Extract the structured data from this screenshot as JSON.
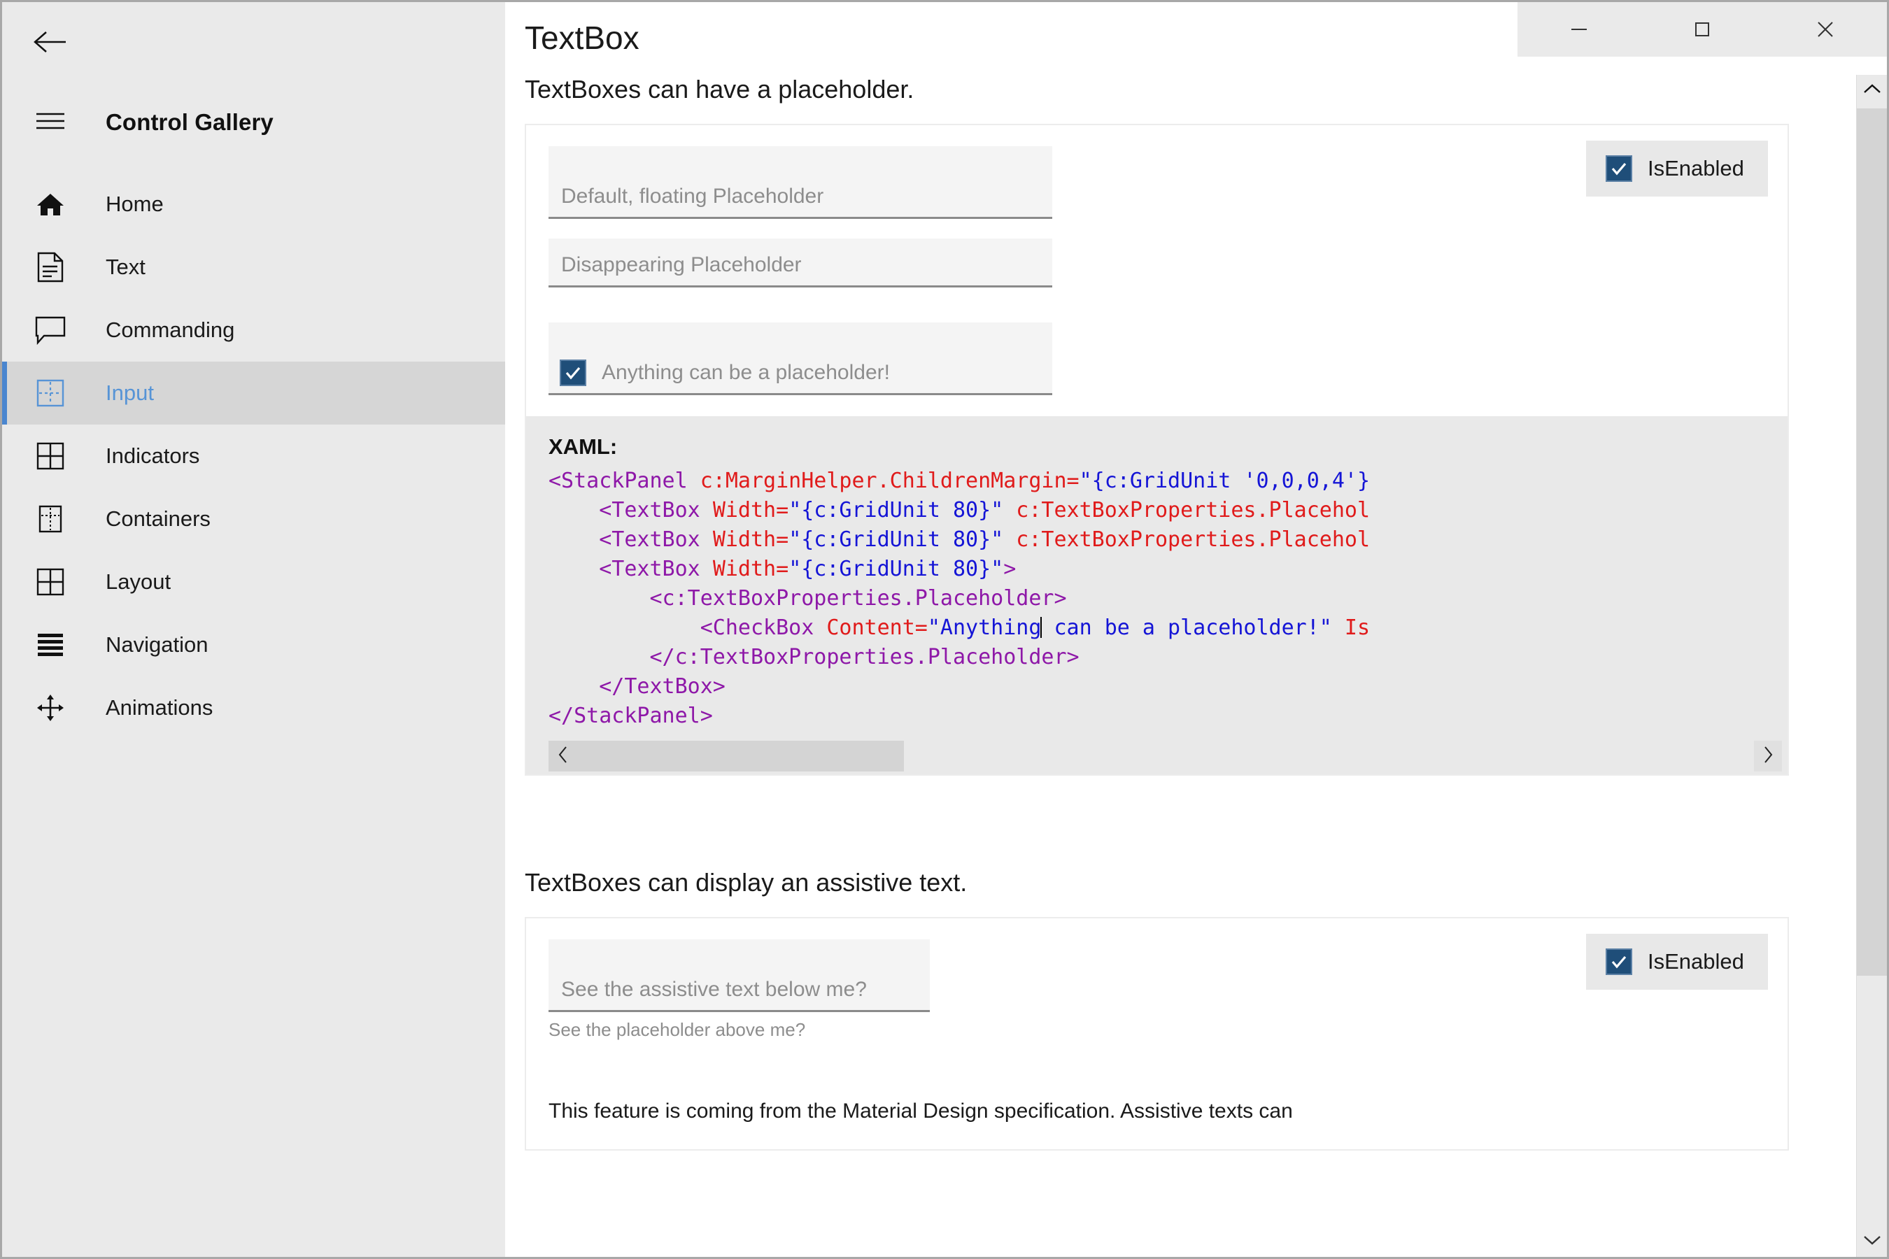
{
  "window": {
    "controls": [
      {
        "name": "minimize",
        "glyph": "minimize-icon"
      },
      {
        "name": "maximize",
        "glyph": "maximize-icon"
      },
      {
        "name": "close",
        "glyph": "close-icon"
      }
    ]
  },
  "sidebar": {
    "back_label": "back-arrow-icon",
    "menu_label": "hamburger-icon",
    "brand": "Control Gallery",
    "items": [
      {
        "label": "Home",
        "icon": "home-icon",
        "selected": false
      },
      {
        "label": "Text",
        "icon": "document-icon",
        "selected": false
      },
      {
        "label": "Commanding",
        "icon": "chat-bubble-icon",
        "selected": false
      },
      {
        "label": "Input",
        "icon": "input-grid-icon",
        "selected": true
      },
      {
        "label": "Indicators",
        "icon": "grid-icon",
        "selected": false
      },
      {
        "label": "Containers",
        "icon": "container-icon",
        "selected": false
      },
      {
        "label": "Layout",
        "icon": "grid-icon",
        "selected": false
      },
      {
        "label": "Navigation",
        "icon": "lines-icon",
        "selected": false
      },
      {
        "label": "Animations",
        "icon": "move-icon",
        "selected": false
      }
    ]
  },
  "main": {
    "title": "TextBox",
    "sections": [
      {
        "heading": "TextBoxes can have a placeholder.",
        "is_enabled_label": "IsEnabled",
        "is_enabled_checked": true,
        "textboxes": [
          {
            "placeholder": "Default, floating Placeholder",
            "value": "",
            "kind": "floating"
          },
          {
            "placeholder": "Disappearing Placeholder",
            "value": "",
            "kind": "plain"
          }
        ],
        "checkbox_placeholder": "Anything can be a placeholder!",
        "checkbox_placeholder_checked": true
      },
      {
        "heading": "TextBoxes can display an assistive text.",
        "is_enabled_label": "IsEnabled",
        "is_enabled_checked": true,
        "textbox": {
          "placeholder": "See the assistive text below me?",
          "value": ""
        },
        "assistive_text": "See the placeholder above me?",
        "note": "This feature is coming from the Material Design specification. Assistive texts can"
      }
    ]
  },
  "xaml": {
    "label": "XAML:",
    "lines": [
      [
        {
          "t": "tag",
          "s": "<StackPanel "
        },
        {
          "t": "attr",
          "s": "c:MarginHelper.ChildrenMargin"
        },
        {
          "t": "eq",
          "s": "="
        },
        {
          "t": "val",
          "s": "\"{c:GridUnit '0,0,0,4'}"
        }
      ],
      [
        {
          "t": "tag",
          "s": "    <TextBox "
        },
        {
          "t": "attr",
          "s": "Width"
        },
        {
          "t": "eq",
          "s": "="
        },
        {
          "t": "val",
          "s": "\"{c:GridUnit 80}\""
        },
        {
          "t": "attr",
          "s": " c:TextBoxProperties.Placehol"
        }
      ],
      [
        {
          "t": "tag",
          "s": "    <TextBox "
        },
        {
          "t": "attr",
          "s": "Width"
        },
        {
          "t": "eq",
          "s": "="
        },
        {
          "t": "val",
          "s": "\"{c:GridUnit 80}\""
        },
        {
          "t": "attr",
          "s": " c:TextBoxProperties.Placehol"
        }
      ],
      [
        {
          "t": "tag",
          "s": "    <TextBox "
        },
        {
          "t": "attr",
          "s": "Width"
        },
        {
          "t": "eq",
          "s": "="
        },
        {
          "t": "val",
          "s": "\"{c:GridUnit 80}\""
        },
        {
          "t": "tag",
          "s": ">"
        }
      ],
      [
        {
          "t": "tag",
          "s": "        <c:TextBoxProperties.Placeholder>"
        }
      ],
      [
        {
          "t": "tag",
          "s": "            <CheckBox "
        },
        {
          "t": "attr",
          "s": "Content"
        },
        {
          "t": "eq",
          "s": "="
        },
        {
          "t": "val",
          "s": "\"Anything"
        },
        {
          "t": "caret",
          "s": ""
        },
        {
          "t": "val",
          "s": " can be a placeholder!\""
        },
        {
          "t": "attr",
          "s": " Is"
        }
      ],
      [
        {
          "t": "tag",
          "s": "        </c:TextBoxProperties.Placeholder>"
        }
      ],
      [
        {
          "t": "tag",
          "s": "    </TextBox>"
        }
      ],
      [
        {
          "t": "tag",
          "s": "</StackPanel>"
        }
      ]
    ],
    "hscroll": {
      "left_arrow": "chevron-left-icon",
      "right_arrow": "chevron-right-icon"
    }
  },
  "scrollbar": {
    "up_arrow": "chevron-up-icon",
    "down_arrow": "chevron-down-icon"
  },
  "colors": {
    "accent": "#4a86cf",
    "checkbox_fill": "#1f4e79",
    "sidebar_bg": "#eaeaea",
    "selected_bg": "#d6d6d6",
    "code_bg": "#e9e9e9",
    "field_bg": "#f4f4f4"
  }
}
